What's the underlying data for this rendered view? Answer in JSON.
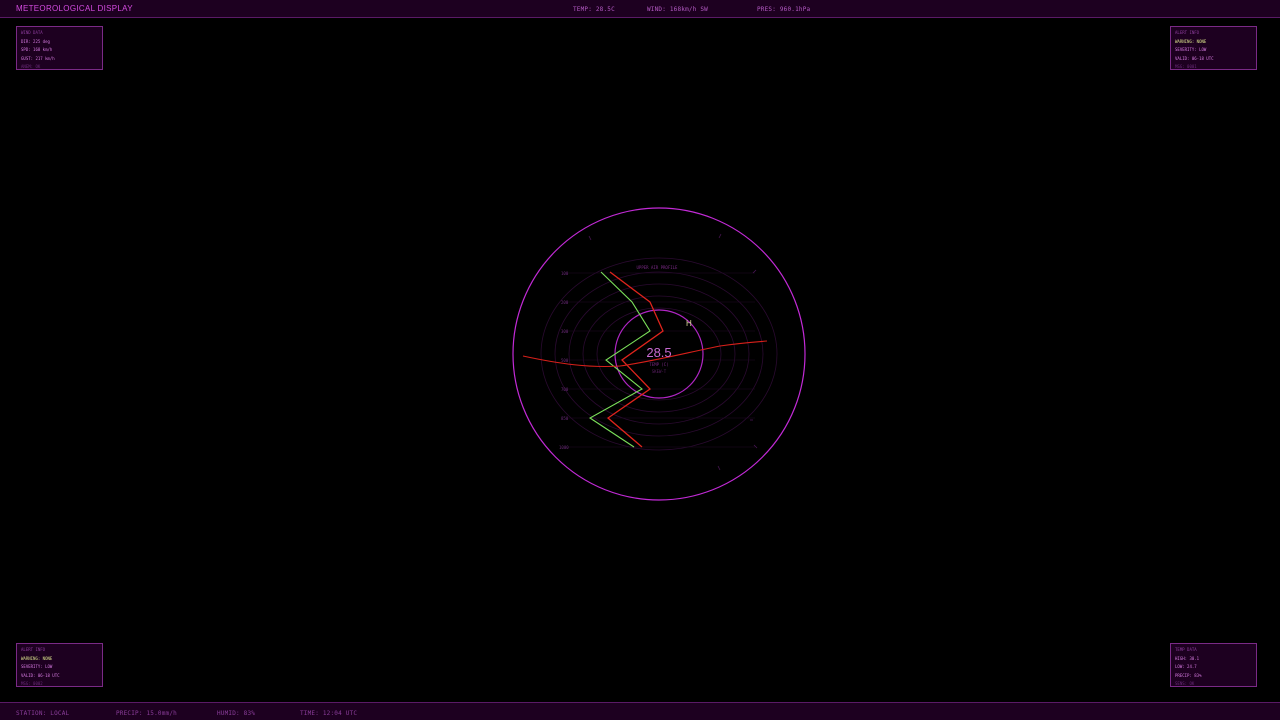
{
  "header": {
    "title": "METEOROLOGICAL  DISPLAY",
    "temp": "TEMP: 28.5C",
    "wind": "WIND: 168km/h SW",
    "pres": "PRES: 960.1hPa"
  },
  "footer": {
    "station": "STATION: LOCAL",
    "precip": "PRECIP: 15.0mm/h",
    "humid": "HUMID: 83%",
    "time": "TIME: 12:04 UTC"
  },
  "panels": {
    "top_left": {
      "title": "WIND DATA",
      "lines": [
        "DIR: 225 deg",
        "SPD: 168 km/h",
        "GUST: 217 km/h"
      ],
      "foot": "ANEM: OK"
    },
    "top_right": {
      "title": "ALERT INFO",
      "lines": [
        "WARNING: NONE",
        "SEVERITY: LOW",
        "VALID: 06-18 UTC"
      ],
      "foot": "MSG: 0001"
    },
    "bottom_left": {
      "title": "ALERT INFO",
      "lines": [
        "WARNING: NONE",
        "SEVERITY: LOW",
        "VALID: 06-18 UTC"
      ],
      "foot": "MSG: 0002"
    },
    "bottom_right": {
      "title": "TEMP DATA",
      "lines": [
        "HIGH: 30.1",
        "LOW: 24.7",
        "PRECIP: 83%"
      ],
      "foot": "SENS: OK"
    }
  },
  "radar": {
    "label": "UPPER AIR PROFILE",
    "center_value": "28.5",
    "center_unit": "TEMP (C)",
    "center_sub": "SKEW-T",
    "high_marker": "H",
    "tick_labels": [
      "100",
      "200",
      "300",
      "500",
      "700",
      "850",
      "1000"
    ]
  },
  "colors": {
    "accent": "#d44be0",
    "temp_line": "#e0241c",
    "dewpoint_line": "#7be05a"
  }
}
